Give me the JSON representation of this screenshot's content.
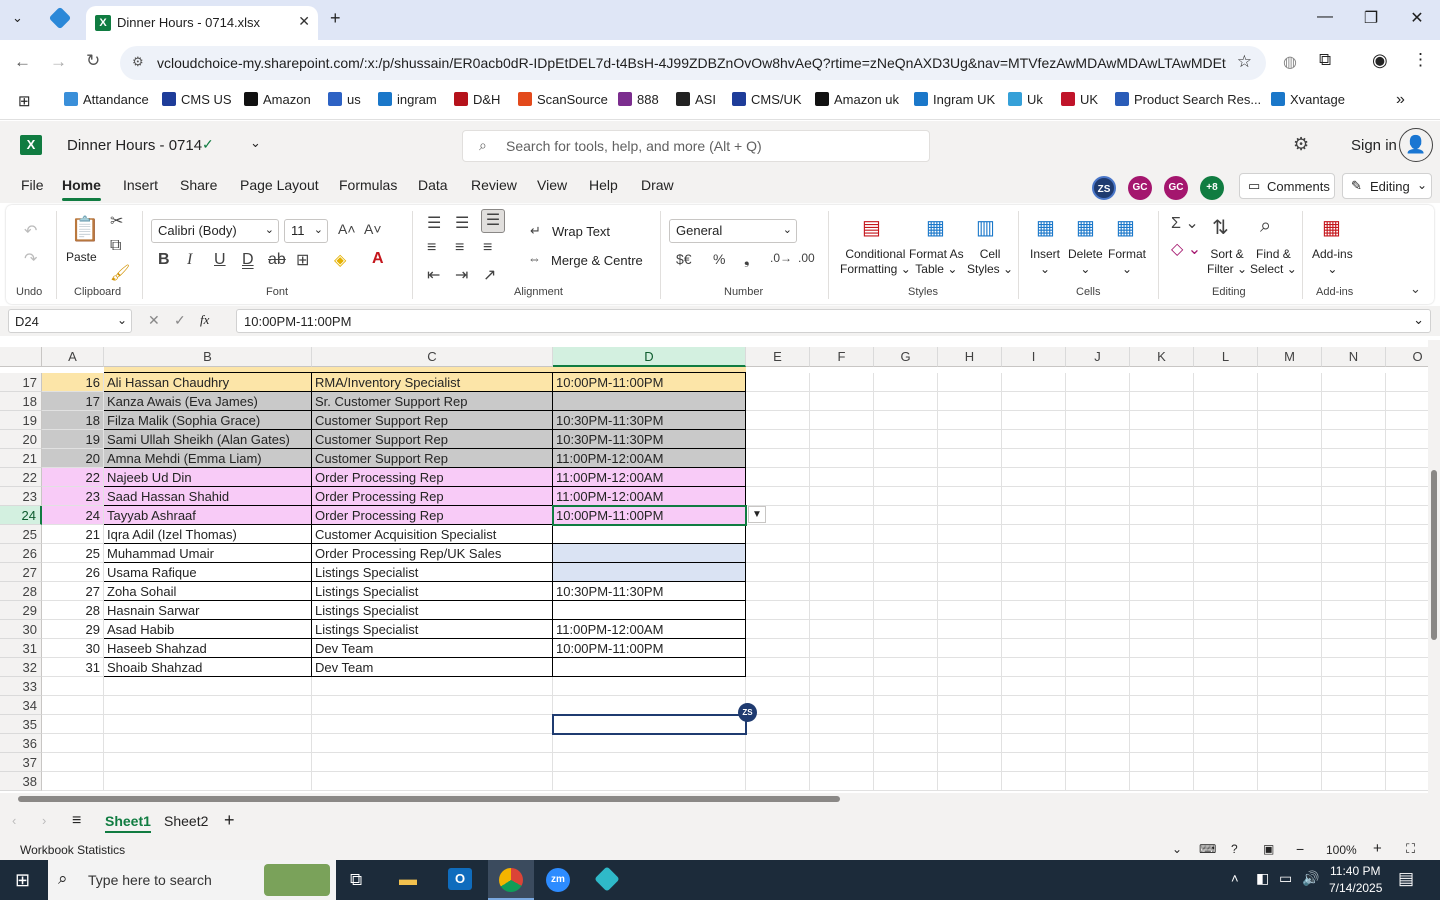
{
  "browser": {
    "tab_title": "Dinner Hours - 0714.xlsx",
    "url": "vcloudchoice-my.sharepoint.com/:x:/p/shussain/ER0acb0dR-IDpEtDEL7d-t4BsH-4J99ZDBZnOvOw8hvAeQ?rtime=zNeQnAXD3Ug&nav=MTVfezAwMDAwMDAwLTAwMDEt...",
    "bookmarks": [
      "Attandance",
      "CMS US",
      "Amazon",
      "us",
      "ingram",
      "D&H",
      "ScanSource",
      "888",
      "ASI",
      "CMS/UK",
      "Amazon uk",
      "Ingram UK",
      "Uk",
      "UK",
      "Product Search Res...",
      "Xvantage"
    ]
  },
  "app": {
    "doc_title": "Dinner Hours - 0714",
    "search_placeholder": "Search for tools, help, and more (Alt + Q)",
    "sign_in": "Sign in",
    "menus": [
      "File",
      "Home",
      "Insert",
      "Share",
      "Page Layout",
      "Formulas",
      "Data",
      "Review",
      "View",
      "Help",
      "Draw"
    ],
    "active_menu": "Home",
    "avatars": [
      "ZS",
      "GC",
      "GC",
      "+8"
    ],
    "comments": "Comments",
    "mode": "Editing"
  },
  "ribbon": {
    "undo": "Undo",
    "clipboard": "Clipboard",
    "paste": "Paste",
    "font_label": "Font",
    "font_name": "Calibri (Body)",
    "font_size": "11",
    "alignment": "Alignment",
    "wrap_text": "Wrap Text",
    "merge": "Merge & Centre",
    "number": "Number",
    "number_format": "General",
    "styles": "Styles",
    "cond_fmt_1": "Conditional",
    "cond_fmt_2": "Formatting",
    "fmt_table_1": "Format As",
    "fmt_table_2": "Table",
    "cell_styles_1": "Cell",
    "cell_styles_2": "Styles",
    "cells": "Cells",
    "insert": "Insert",
    "delete": "Delete",
    "format": "Format",
    "editing": "Editing",
    "sort_1": "Sort &",
    "sort_2": "Filter",
    "find_1": "Find &",
    "find_2": "Select",
    "addins": "Add-ins",
    "addins_btn": "Add-ins"
  },
  "formula_bar": {
    "name_box": "D24",
    "fx": "fx",
    "value": "10:00PM-11:00PM"
  },
  "columns": [
    "A",
    "B",
    "C",
    "D",
    "E",
    "F",
    "G",
    "H",
    "I",
    "J",
    "K",
    "L",
    "M",
    "N",
    "O"
  ],
  "rows": [
    {
      "n": "17",
      "a": "16",
      "b": "Ali Hassan Chaudhry",
      "c": "RMA/Inventory Specialist",
      "d": "10:00PM-11:00PM",
      "color": "#fce5a8"
    },
    {
      "n": "18",
      "a": "17",
      "b": "Kanza Awais (Eva James)",
      "c": "Sr. Customer Support Rep",
      "d": "",
      "color": "#c9c9c9"
    },
    {
      "n": "19",
      "a": "18",
      "b": "Filza Malik (Sophia Grace)",
      "c": "Customer Support Rep",
      "d": "10:30PM-11:30PM",
      "color": "#c9c9c9"
    },
    {
      "n": "20",
      "a": "19",
      "b": "Sami Ullah Sheikh (Alan Gates)",
      "c": "Customer Support Rep",
      "d": "10:30PM-11:30PM",
      "color": "#c9c9c9"
    },
    {
      "n": "21",
      "a": "20",
      "b": "Amna Mehdi (Emma Liam)",
      "c": "Customer Support Rep",
      "d": "11:00PM-12:00AM",
      "color": "#c9c9c9"
    },
    {
      "n": "22",
      "a": "22",
      "b": "Najeeb Ud Din",
      "c": "Order Processing Rep",
      "d": "11:00PM-12:00AM",
      "color": "#f8cbf7"
    },
    {
      "n": "23",
      "a": "23",
      "b": "Saad Hassan Shahid",
      "c": "Order Processing Rep",
      "d": "11:00PM-12:00AM",
      "color": "#f8cbf7"
    },
    {
      "n": "24",
      "a": "24",
      "b": "Tayyab Ashraaf",
      "c": "Order Processing Rep",
      "d": "10:00PM-11:00PM",
      "color": "#f8cbf7"
    },
    {
      "n": "25",
      "a": "21",
      "b": "Iqra Adil (Izel Thomas)",
      "c": "Customer Acquisition Specialist",
      "d": "",
      "color": ""
    },
    {
      "n": "26",
      "a": "25",
      "b": "Muhammad Umair",
      "c": "Order Processing Rep/UK Sales",
      "d": "",
      "color": "",
      "dcolor": "#dae3f3"
    },
    {
      "n": "27",
      "a": "26",
      "b": "Usama Rafique",
      "c": "Listings Specialist",
      "d": "",
      "color": "",
      "dcolor": "#dae3f3"
    },
    {
      "n": "28",
      "a": "27",
      "b": "Zoha Sohail",
      "c": "Listings Specialist",
      "d": "10:30PM-11:30PM",
      "color": ""
    },
    {
      "n": "29",
      "a": "28",
      "b": "Hasnain Sarwar",
      "c": "Listings Specialist",
      "d": "",
      "color": ""
    },
    {
      "n": "30",
      "a": "29",
      "b": "Asad Habib",
      "c": "Listings Specialist",
      "d": "11:00PM-12:00AM",
      "color": ""
    },
    {
      "n": "31",
      "a": "30",
      "b": "Haseeb Shahzad",
      "c": "Dev Team",
      "d": "10:00PM-11:00PM",
      "color": ""
    },
    {
      "n": "32",
      "a": "31",
      "b": "Shoaib Shahzad",
      "c": "Dev Team",
      "d": "",
      "color": ""
    },
    {
      "n": "33"
    },
    {
      "n": "34"
    },
    {
      "n": "35"
    },
    {
      "n": "36"
    },
    {
      "n": "37"
    },
    {
      "n": "38"
    }
  ],
  "collab_badge": "ZS",
  "sheets": [
    "Sheet1",
    "Sheet2"
  ],
  "active_sheet": "Sheet1",
  "status": {
    "left": "Workbook Statistics",
    "zoom": "100%"
  },
  "taskbar": {
    "search": "Type here to search",
    "time": "11:40 PM",
    "date": "7/14/2025"
  }
}
